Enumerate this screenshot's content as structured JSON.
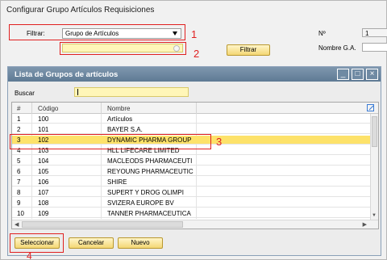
{
  "window": {
    "title": "Configurar Grupo Artículos Requisiciones"
  },
  "filter": {
    "label": "Filtrar:",
    "value": "Grupo de Artículos",
    "filter_button": "Filtrar"
  },
  "right_fields": {
    "num_label": "Nº",
    "num_value": "1",
    "nga_label": "Nombre G.A."
  },
  "annotations": {
    "n1": "1",
    "n2": "2",
    "n3": "3",
    "n4": "4"
  },
  "dialog": {
    "title": "Lista de Grupos de artículos",
    "window_buttons": {
      "minimize": "_",
      "maximize": "□",
      "close": "×"
    },
    "search_label": "Buscar",
    "columns": [
      "#",
      "Código",
      "Nombre"
    ],
    "rows": [
      {
        "num": "1",
        "code": "100",
        "name": "Artículos"
      },
      {
        "num": "2",
        "code": "101",
        "name": "BAYER S.A."
      },
      {
        "num": "3",
        "code": "102",
        "name": "DYNAMIC PHARMA GROUP"
      },
      {
        "num": "4",
        "code": "103",
        "name": "HLL LIFECARE LIMITED"
      },
      {
        "num": "5",
        "code": "104",
        "name": "MACLEODS PHARMACEUTI"
      },
      {
        "num": "6",
        "code": "105",
        "name": "REYOUNG PHARMACEUTIC"
      },
      {
        "num": "7",
        "code": "106",
        "name": "SHIRE"
      },
      {
        "num": "8",
        "code": "107",
        "name": "SUPERT Y DROG OLIMPI"
      },
      {
        "num": "9",
        "code": "108",
        "name": "SVIZERA EUROPE BV"
      },
      {
        "num": "10",
        "code": "109",
        "name": "TANNER PHARMACEUTICA"
      }
    ],
    "selected_row": 3,
    "buttons": {
      "select": "Seleccionar",
      "cancel": "Cancelar",
      "new": "Nuevo"
    }
  },
  "colors": {
    "selection": "#fde26a",
    "annotation": "#e02020",
    "title_bar": "#6a86a0"
  }
}
